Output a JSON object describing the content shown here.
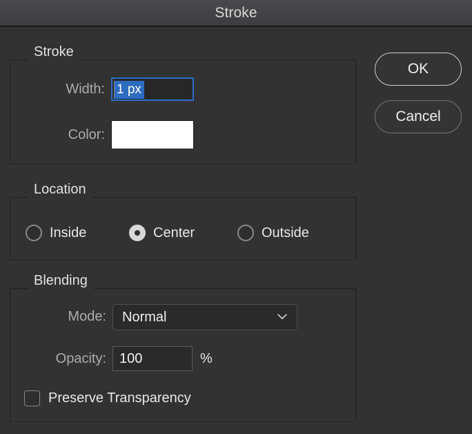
{
  "window": {
    "title": "Stroke"
  },
  "buttons": {
    "ok": "OK",
    "cancel": "Cancel"
  },
  "stroke_group": {
    "legend": "Stroke",
    "width_label": "Width:",
    "width_value": "1 px",
    "width_selected": true,
    "color_label": "Color:",
    "color_value": "#ffffff"
  },
  "location_group": {
    "legend": "Location",
    "options": [
      {
        "label": "Inside",
        "selected": false
      },
      {
        "label": "Center",
        "selected": true
      },
      {
        "label": "Outside",
        "selected": false
      }
    ]
  },
  "blending_group": {
    "legend": "Blending",
    "mode_label": "Mode:",
    "mode_value": "Normal",
    "mode_chevron_icon": "chevron-down-icon",
    "opacity_label": "Opacity:",
    "opacity_value": "100",
    "opacity_unit": "%",
    "preserve_transparency_label": "Preserve Transparency",
    "preserve_transparency_checked": false
  },
  "colors": {
    "dialog_background": "#323232",
    "titlebar_top": "#4a4a4d",
    "titlebar_bottom": "#3d3d40",
    "focus_border": "#2c6ed0",
    "selection_highlight": "#2d6cc0",
    "group_border": "#1f1f1f",
    "text_primary": "#e8e8e8",
    "text_secondary": "#acacac"
  }
}
